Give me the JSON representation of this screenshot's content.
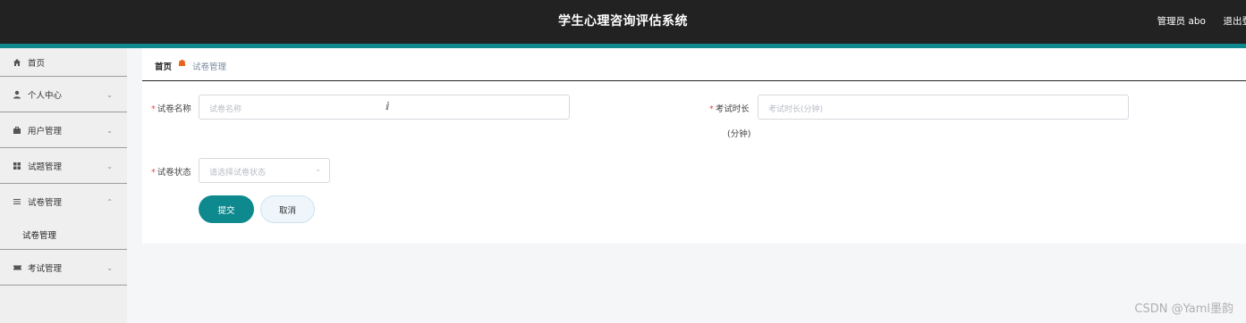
{
  "header": {
    "title": "学生心理咨询评估系统",
    "admin_label": "管理员 abo",
    "logout_label": "退出登"
  },
  "sidebar": {
    "items": [
      {
        "label": "首页",
        "icon": "home-icon"
      },
      {
        "label": "个人中心",
        "icon": "user-icon"
      },
      {
        "label": "用户管理",
        "icon": "briefcase-icon"
      },
      {
        "label": "试题管理",
        "icon": "grid-icon"
      },
      {
        "label": "试卷管理",
        "icon": "list-icon"
      },
      {
        "label": "考试管理",
        "icon": "ticket-icon"
      }
    ],
    "sub_item": "试卷管理"
  },
  "breadcrumb": {
    "home": "首页",
    "current": "试卷管理"
  },
  "form": {
    "name_label": "试卷名称",
    "name_placeholder": "试卷名称",
    "duration_label": "考试时长",
    "duration_unit": "(分钟)",
    "duration_placeholder": "考试时长(分钟)",
    "status_label": "试卷状态",
    "status_placeholder": "请选择试卷状态",
    "submit_label": "提交",
    "cancel_label": "取消"
  },
  "watermark": "CSDN @Yaml墨韵",
  "colors": {
    "topbar": "#222222",
    "accent": "#0e8a8f",
    "breadcrumb_separator": "#e8641b",
    "required_star": "#e24b4b"
  }
}
